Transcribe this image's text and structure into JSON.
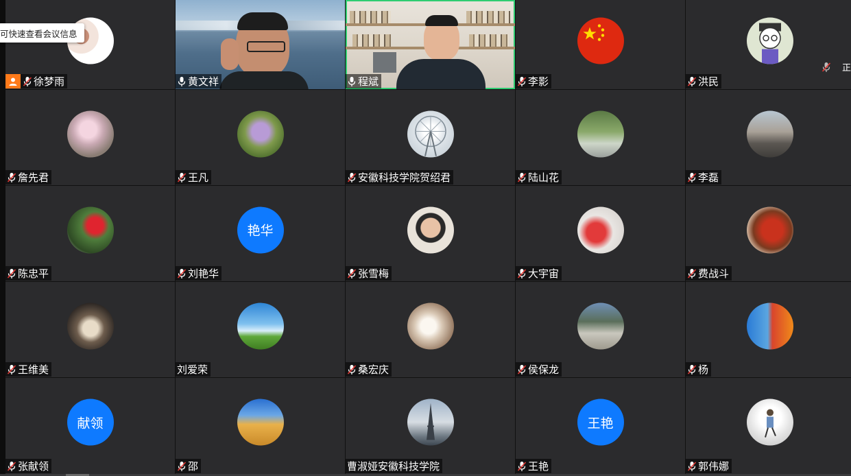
{
  "tooltip": "可快速查看会议信息",
  "speaking_text": "正",
  "colors": {
    "tile_bg": "#2b2b2d",
    "active_border": "#2ecc71",
    "text_avatar_bg": "#0e7aff",
    "host_badge": "#ff7a1a"
  },
  "participants": [
    {
      "name": "徐梦雨",
      "mic": "muted",
      "host": true,
      "avatar": "photo"
    },
    {
      "name": "黄文祥",
      "mic": "on",
      "video": true
    },
    {
      "name": "程斌",
      "mic": "on",
      "video": true,
      "active": true
    },
    {
      "name": "李影",
      "mic": "muted",
      "avatar": "china-flag"
    },
    {
      "name": "洪民",
      "mic": "muted",
      "avatar": "cartoon"
    },
    {
      "name": "詹先君",
      "mic": "muted",
      "avatar": "photo"
    },
    {
      "name": "王凡",
      "mic": "muted",
      "avatar": "photo"
    },
    {
      "name": "安徽科技学院贺绍君",
      "mic": "muted",
      "avatar": "photo"
    },
    {
      "name": "陆山花",
      "mic": "muted",
      "avatar": "photo"
    },
    {
      "name": "李磊",
      "mic": "muted",
      "avatar": "photo"
    },
    {
      "name": "陈忠平",
      "mic": "muted",
      "avatar": "photo"
    },
    {
      "name": "刘艳华",
      "mic": "muted",
      "avatar_text": "艳华"
    },
    {
      "name": "张雪梅",
      "mic": "muted",
      "avatar": "photo"
    },
    {
      "name": "大宇宙",
      "mic": "muted",
      "avatar": "photo"
    },
    {
      "name": "费战斗",
      "mic": "muted",
      "avatar": "photo"
    },
    {
      "name": "王维美",
      "mic": "muted",
      "avatar": "photo"
    },
    {
      "name": "刘爱荣",
      "mic": "none",
      "avatar": "photo"
    },
    {
      "name": "桑宏庆",
      "mic": "muted",
      "avatar": "photo"
    },
    {
      "name": "侯保龙",
      "mic": "muted",
      "avatar": "photo"
    },
    {
      "name": "杨",
      "mic": "muted",
      "avatar": "photo"
    },
    {
      "name": "张献领",
      "mic": "muted",
      "avatar_text": "献领"
    },
    {
      "name": "邵",
      "mic": "muted",
      "avatar": "photo"
    },
    {
      "name": "曹淑娅安徽科技学院",
      "mic": "none",
      "avatar": "photo"
    },
    {
      "name": "王艳",
      "mic": "muted",
      "avatar_text": "王艳"
    },
    {
      "name": "郭伟娜",
      "mic": "muted",
      "avatar": "photo"
    }
  ]
}
